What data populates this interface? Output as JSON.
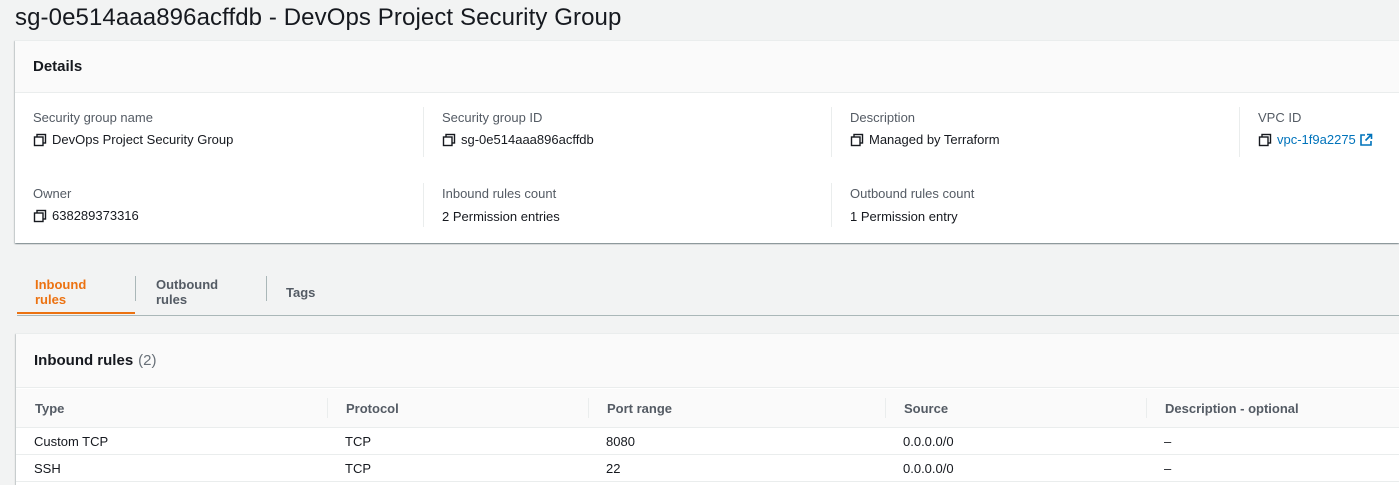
{
  "page": {
    "title": "sg-0e514aaa896acffdb - DevOps Project Security Group"
  },
  "details": {
    "title": "Details",
    "sg_name_label": "Security group name",
    "sg_name_value": "DevOps Project Security Group",
    "sg_id_label": "Security group ID",
    "sg_id_value": "sg-0e514aaa896acffdb",
    "description_label": "Description",
    "description_value": "Managed by Terraform",
    "vpc_label": "VPC ID",
    "vpc_value": "vpc-1f9a2275",
    "owner_label": "Owner",
    "owner_value": "638289373316",
    "inbound_count_label": "Inbound rules count",
    "inbound_count_value": "2 Permission entries",
    "outbound_count_label": "Outbound rules count",
    "outbound_count_value": "1 Permission entry"
  },
  "tabs": [
    {
      "label": "Inbound rules",
      "active": true
    },
    {
      "label": "Outbound rules",
      "active": false
    },
    {
      "label": "Tags",
      "active": false
    }
  ],
  "inbound": {
    "title": "Inbound rules",
    "count": "(2)",
    "columns": [
      "Type",
      "Protocol",
      "Port range",
      "Source",
      "Description - optional"
    ],
    "rows": [
      [
        "Custom TCP",
        "TCP",
        "8080",
        "0.0.0.0/0",
        "–"
      ],
      [
        "SSH",
        "TCP",
        "22",
        "0.0.0.0/0",
        "–"
      ]
    ]
  },
  "colors": {
    "accent": "#ec7211",
    "link": "#0073bb",
    "background": "#f2f3f3"
  },
  "icons": [
    "copy-icon",
    "external-link-icon"
  ]
}
